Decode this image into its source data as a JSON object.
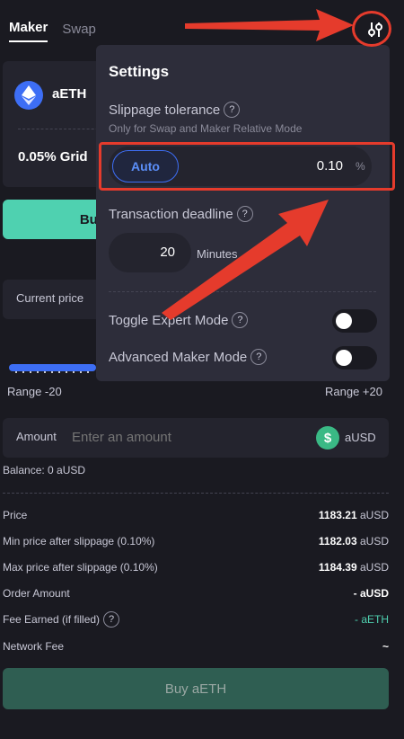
{
  "tabs": {
    "maker": "Maker",
    "swap": "Swap"
  },
  "pair": {
    "token": "aETH",
    "grid": "0.05% Grid"
  },
  "buy_tab_label": "Buy",
  "current_price_label": "Current price",
  "range": {
    "low": "Range -20",
    "high": "Range +20"
  },
  "amount": {
    "label": "Amount",
    "placeholder": "Enter an amount",
    "token": "aUSD",
    "token_icon": "$"
  },
  "balance": "Balance: 0 aUSD",
  "info": {
    "price": {
      "label": "Price",
      "value": "1183.21",
      "unit": "aUSD"
    },
    "min_price": {
      "label": "Min price after slippage (0.10%)",
      "value": "1182.03",
      "unit": "aUSD"
    },
    "max_price": {
      "label": "Max price after slippage (0.10%)",
      "value": "1184.39",
      "unit": "aUSD"
    },
    "order_amount": {
      "label": "Order Amount",
      "value": "- aUSD"
    },
    "fee_earned": {
      "label": "Fee Earned (if filled)",
      "value": "- aETH"
    },
    "network_fee": {
      "label": "Network Fee",
      "value": "~"
    }
  },
  "buy_button": "Buy aETH",
  "settings": {
    "title": "Settings",
    "slippage_label": "Slippage tolerance",
    "slippage_sub": "Only for Swap and Maker Relative Mode",
    "auto_label": "Auto",
    "slippage_value": "0.10",
    "slippage_unit": "%",
    "deadline_label": "Transaction deadline",
    "deadline_value": "20",
    "deadline_unit": "Minutes",
    "expert_mode_label": "Toggle Expert Mode",
    "advanced_maker_label": "Advanced Maker Mode",
    "help_glyph": "?"
  },
  "colors": {
    "accent_blue": "#3d6ef5",
    "green": "#4fd1b0",
    "annotation_red": "#e53b2c"
  }
}
